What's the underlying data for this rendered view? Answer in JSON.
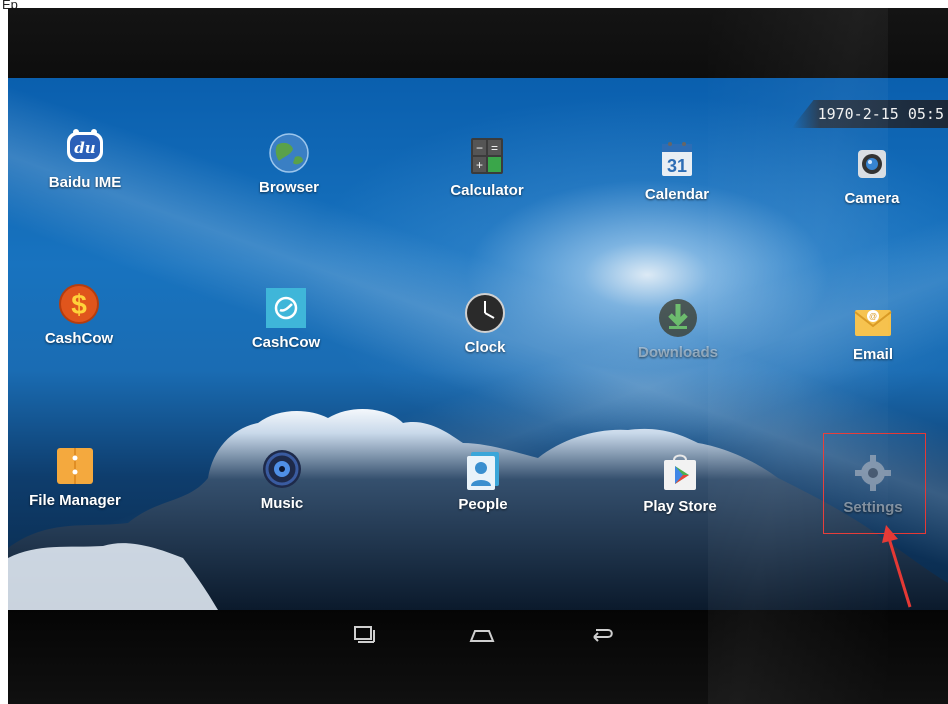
{
  "header_text": "Ep",
  "status": {
    "datetime": "1970-2-15 05:5"
  },
  "apps": [
    {
      "label": "Baidu IME",
      "icon": "baidu-ime-icon"
    },
    {
      "label": "Browser",
      "icon": "browser-globe-icon"
    },
    {
      "label": "Calculator",
      "icon": "calculator-icon"
    },
    {
      "label": "Calendar",
      "icon": "calendar-icon",
      "day": "31"
    },
    {
      "label": "Camera",
      "icon": "camera-icon"
    },
    {
      "label": "CashCow",
      "icon": "cashcow-dollar-icon"
    },
    {
      "label": "CashCow",
      "icon": "cashcow-teal-icon"
    },
    {
      "label": "Clock",
      "icon": "clock-icon"
    },
    {
      "label": "Downloads",
      "icon": "downloads-icon"
    },
    {
      "label": "Email",
      "icon": "email-icon"
    },
    {
      "label": "File Manager",
      "icon": "file-manager-icon"
    },
    {
      "label": "Music",
      "icon": "music-icon"
    },
    {
      "label": "People",
      "icon": "people-icon"
    },
    {
      "label": "Play Store",
      "icon": "play-store-icon"
    },
    {
      "label": "Settings",
      "icon": "settings-gear-icon"
    }
  ],
  "navigation": {
    "buttons": [
      "recent-apps",
      "home",
      "back"
    ]
  },
  "annotation": {
    "highlighted_app": "Settings",
    "color": "#e53935"
  }
}
